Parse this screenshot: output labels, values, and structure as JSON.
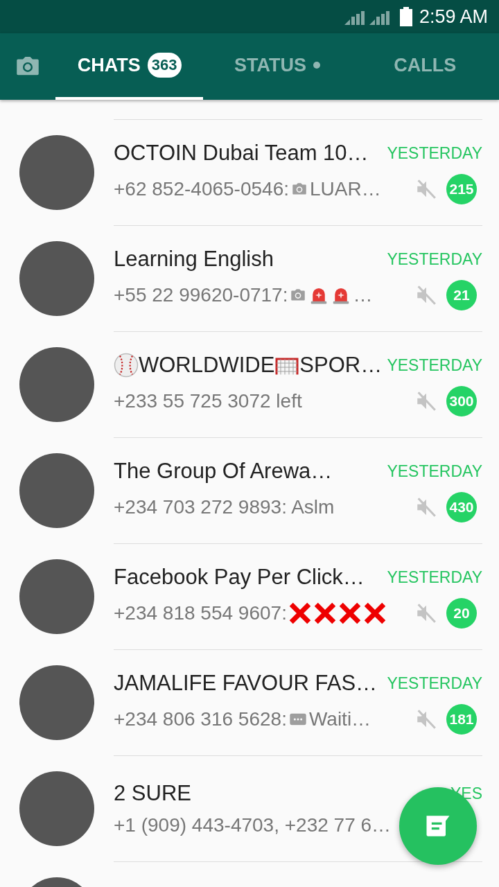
{
  "status_bar": {
    "time": "2:59 AM"
  },
  "tabs": [
    {
      "kind": "camera",
      "selected": false
    },
    {
      "kind": "label",
      "label": "CHATS",
      "badge": "363",
      "selected": true
    },
    {
      "kind": "label",
      "label": "STATUS",
      "dot": true,
      "selected": false
    },
    {
      "kind": "label",
      "label": "CALLS",
      "selected": false
    }
  ],
  "chats": [
    {
      "title": [
        {
          "kind": "text",
          "text": "OCTOIN Dubai Team 10…"
        }
      ],
      "time": "YESTERDAY",
      "preview": [
        {
          "kind": "text",
          "text": "+62 852-4065-0546: "
        },
        {
          "kind": "photo"
        },
        {
          "kind": "text",
          "text": " LUAR…"
        }
      ],
      "muted": true,
      "unread": "215"
    },
    {
      "title": [
        {
          "kind": "text",
          "text": "Learning English"
        }
      ],
      "time": "YESTERDAY",
      "preview": [
        {
          "kind": "text",
          "text": "+55 22 99620-0717: "
        },
        {
          "kind": "photo"
        },
        {
          "kind": "alarm"
        },
        {
          "kind": "alarm"
        },
        {
          "kind": "text",
          "text": " …"
        }
      ],
      "muted": true,
      "unread": "21"
    },
    {
      "title": [
        {
          "kind": "ball"
        },
        {
          "kind": "text",
          "text": "WORLDWIDE"
        },
        {
          "kind": "goal"
        },
        {
          "kind": "text",
          "text": "SPOR…"
        }
      ],
      "time": "YESTERDAY",
      "preview": [
        {
          "kind": "text",
          "text": "+233 55 725 3072 left"
        }
      ],
      "muted": true,
      "unread": "300"
    },
    {
      "title": [
        {
          "kind": "text",
          "text": "The Group Of Arewa…"
        }
      ],
      "time": "YESTERDAY",
      "preview": [
        {
          "kind": "text",
          "text": "+234 703 272 9893: Aslm"
        }
      ],
      "muted": true,
      "unread": "430"
    },
    {
      "title": [
        {
          "kind": "text",
          "text": "Facebook Pay Per Click…"
        }
      ],
      "time": "YESTERDAY",
      "preview": [
        {
          "kind": "text",
          "text": "+234 818 554 9607: "
        },
        {
          "kind": "cross"
        },
        {
          "kind": "cross"
        },
        {
          "kind": "cross"
        },
        {
          "kind": "cross"
        }
      ],
      "muted": true,
      "unread": "20"
    },
    {
      "title": [
        {
          "kind": "text",
          "text": "JAMALIFE FAVOUR FAS…"
        }
      ],
      "time": "YESTERDAY",
      "preview": [
        {
          "kind": "text",
          "text": "+234 806 316 5628: "
        },
        {
          "kind": "message"
        },
        {
          "kind": "text",
          "text": " Waiti…"
        }
      ],
      "muted": true,
      "unread": "181"
    },
    {
      "title": [
        {
          "kind": "text",
          "text": "2 SURE"
        }
      ],
      "time": "YES",
      "preview": [
        {
          "kind": "text",
          "text": "+1 (909) 443-4703, +232 77 6…"
        }
      ],
      "muted": false
    }
  ]
}
